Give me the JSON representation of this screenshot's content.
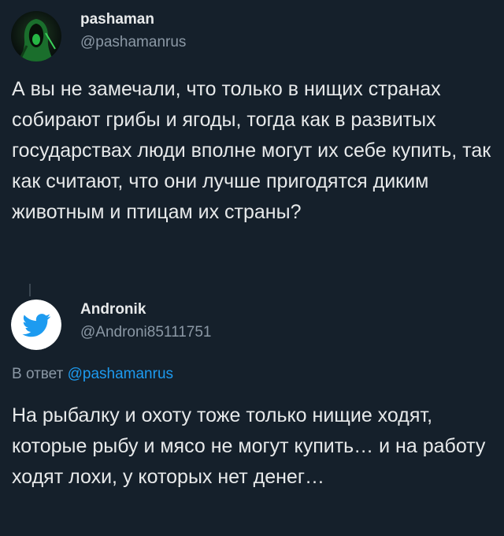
{
  "tweet_original": {
    "author_name": "pashaman",
    "author_handle": "@pashamanrus",
    "text": "А вы не замечали, что только в нищих странах собирают грибы и ягоды, тогда как в развитых государствах люди вполне могут их себе купить, так как считают, что они лучше пригодятся диким животным и птицам их страны?",
    "avatar_icon": "hooded-archer-avatar"
  },
  "tweet_reply": {
    "author_name": "Andronik",
    "author_handle": "@Androni85111751",
    "reply_prefix": "В ответ",
    "reply_mention": "@pashamanrus",
    "text": "На рыбалку и охоту тоже только нищие ходят, которые рыбу и мясо не могут купить… и на работу ходят лохи, у которых нет денег…",
    "avatar_icon": "twitter-bird-avatar"
  },
  "colors": {
    "background": "#15202b",
    "primary_text": "#e7e9ea",
    "secondary_text": "#8b98a5",
    "accent": "#1d9bf0"
  }
}
